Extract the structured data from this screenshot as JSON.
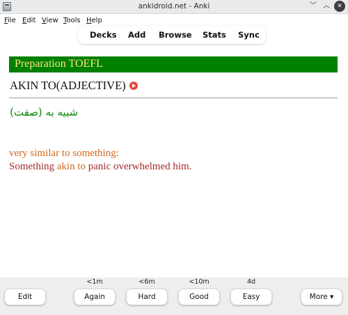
{
  "window": {
    "title": "ankidroid.net - Anki",
    "min_icon": "chevron-down-icon",
    "max_icon": "chevron-up-icon",
    "close_icon": "close-icon"
  },
  "menu": {
    "file": {
      "accel": "F",
      "rest": "ile"
    },
    "edit": {
      "accel": "E",
      "rest": "dit"
    },
    "view": {
      "accel": "V",
      "rest": "iew"
    },
    "tools": {
      "accel": "T",
      "rest": "ools"
    },
    "help": {
      "accel": "H",
      "rest": "elp"
    }
  },
  "toolbar": {
    "decks": "Decks",
    "add": "Add",
    "browse": "Browse",
    "stats": "Stats",
    "sync": "Sync"
  },
  "card": {
    "deck": "Preparation TOEFL",
    "word": "AKIN TO(ADJECTIVE)",
    "translation": "شبیه به (صفت)",
    "definition": "very similar to something:",
    "example_before": "Something ",
    "example_highlight": "akin to",
    "example_after": " panic overwhelmed him.",
    "colors": {
      "banner": "#008000",
      "deck_text": "#ffe680",
      "translation": "#0a8a0a",
      "definition": "#d2691e",
      "example": "#a52a2a"
    }
  },
  "answer_bar": {
    "edit": "Edit",
    "again": {
      "label": "Again",
      "due": "<1m"
    },
    "hard": {
      "label": "Hard",
      "due": "<6m"
    },
    "good": {
      "label": "Good",
      "due": "<10m"
    },
    "easy": {
      "label": "Easy",
      "due": "4d"
    },
    "more": "More ▾"
  }
}
